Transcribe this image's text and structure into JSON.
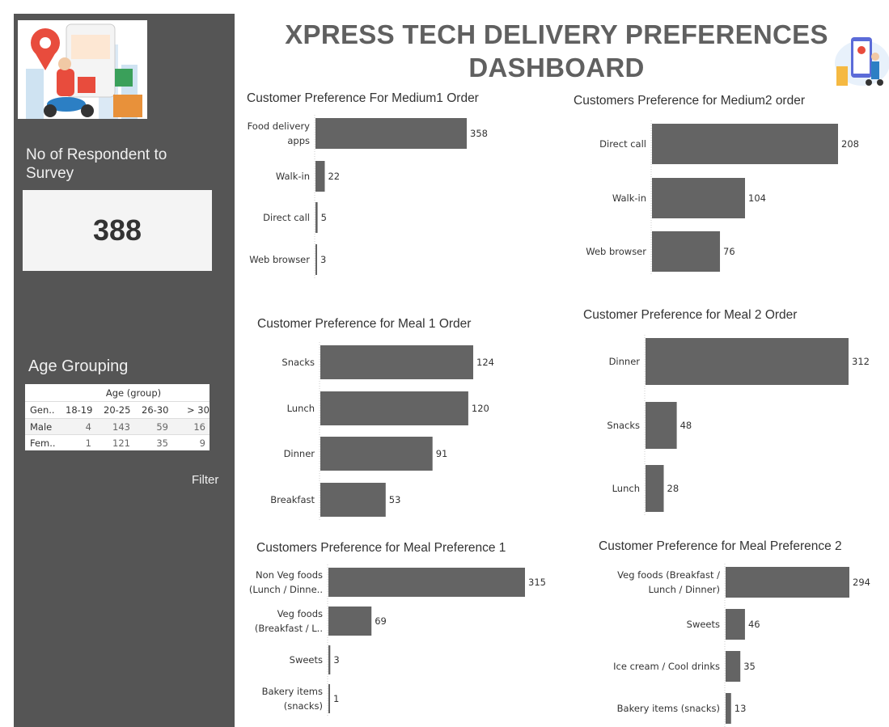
{
  "dashboard": {
    "title_line1": "XPRESS TECH DELIVERY PREFERENCES",
    "title_line2": "DASHBOARD"
  },
  "sidebar": {
    "respondents_title": "No of Respondent to Survey",
    "respondents_value": "388",
    "age_title": "Age Grouping",
    "filter_label": "Filter",
    "age_table": {
      "group_header": "Age (group)",
      "row_header": "Gen..",
      "columns": [
        "18-19",
        "20-25",
        "26-30",
        "> 30"
      ],
      "rows": [
        {
          "label": "Male",
          "values": [
            "4",
            "143",
            "59",
            "16"
          ]
        },
        {
          "label": "Fem..",
          "values": [
            "1",
            "121",
            "35",
            "9"
          ]
        }
      ]
    }
  },
  "colors": {
    "bar": "#646464",
    "sidebar": "#555555",
    "title": "#606060"
  },
  "charts": {
    "medium1": {
      "title": "Customer Preference For Medium1 Order"
    },
    "medium2": {
      "title": "Customers Preference for Medium2 order"
    },
    "meal1": {
      "title": "Customer Preference for Meal 1 Order"
    },
    "meal2": {
      "title": "Customer Preference for Meal 2 Order"
    },
    "pref1": {
      "title": "Customers Preference for Meal Preference 1"
    },
    "pref2": {
      "title": "Customer Preference for Meal Preference 2"
    }
  },
  "chart_data": [
    {
      "type": "bar",
      "title": "Customer Preference For Medium1 Order",
      "categories": [
        [
          "Food delivery",
          "apps"
        ],
        [
          "Walk-in"
        ],
        [
          "Direct call"
        ],
        [
          "Web browser"
        ]
      ],
      "values": [
        358,
        22,
        5,
        3
      ]
    },
    {
      "type": "bar",
      "title": "Customers Preference for Medium2 order",
      "categories": [
        [
          "Direct call"
        ],
        [
          "Walk-in"
        ],
        [
          "Web browser"
        ]
      ],
      "values": [
        208,
        104,
        76
      ]
    },
    {
      "type": "bar",
      "title": "Customer Preference for Meal 1 Order",
      "categories": [
        [
          "Snacks"
        ],
        [
          "Lunch"
        ],
        [
          "Dinner"
        ],
        [
          "Breakfast"
        ]
      ],
      "values": [
        124,
        120,
        91,
        53
      ]
    },
    {
      "type": "bar",
      "title": "Customer Preference for Meal 2 Order",
      "categories": [
        [
          "Dinner"
        ],
        [
          "Snacks"
        ],
        [
          "Lunch"
        ]
      ],
      "values": [
        312,
        48,
        28
      ]
    },
    {
      "type": "bar",
      "title": "Customers Preference for Meal Preference 1",
      "categories": [
        [
          "Non Veg foods",
          "(Lunch / Dinne.."
        ],
        [
          "Veg foods",
          "(Breakfast / L.."
        ],
        [
          "Sweets"
        ],
        [
          "Bakery items",
          "(snacks)"
        ]
      ],
      "values": [
        315,
        69,
        3,
        1
      ]
    },
    {
      "type": "bar",
      "title": "Customer Preference for Meal Preference 2",
      "categories": [
        [
          "Veg foods (Breakfast /",
          "Lunch / Dinner)"
        ],
        [
          "Sweets"
        ],
        [
          "Ice cream / Cool drinks"
        ],
        [
          "Bakery items (snacks)"
        ]
      ],
      "values": [
        294,
        46,
        35,
        13
      ]
    }
  ]
}
